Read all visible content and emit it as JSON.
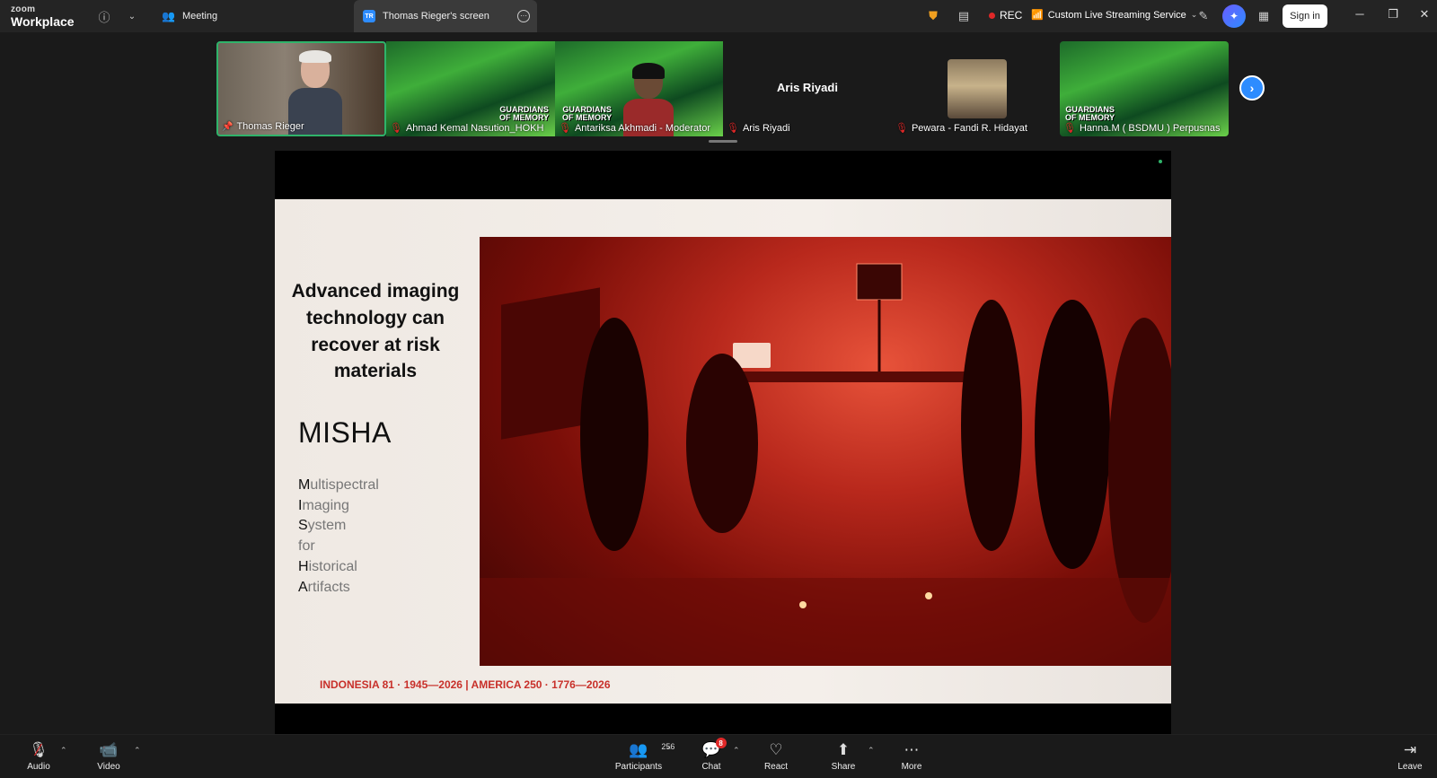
{
  "titlebar": {
    "brand_top": "zoom",
    "brand_bottom": "Workplace",
    "tab_meeting": "Meeting",
    "tab_screen": "Thomas Rieger's screen",
    "tab_screen_badge": "TR",
    "rec": "REC",
    "stream": "Custom Live Streaming Service",
    "signin": "Sign in"
  },
  "participants": [
    {
      "name": "Thomas Rieger",
      "muted": false,
      "pinned": true
    },
    {
      "name": "Ahmad Kemal Nasution_HOKH",
      "muted": true
    },
    {
      "name": "Antariksa Akhmadi - Moderator",
      "muted": true
    },
    {
      "name": "Aris Riyadi",
      "muted": true,
      "display_name": "Aris Riyadi"
    },
    {
      "name": "Pewara - Fandi R. Hidayat",
      "muted": true
    },
    {
      "name": "Hanna.M ( BSDMU ) Perpusnas",
      "muted": true
    }
  ],
  "thumb_branding": {
    "line1": "GUARDIANS",
    "line2": "OF MEMORY"
  },
  "slide": {
    "title": "Advanced imaging technology  can recover at risk materials",
    "acronym_title": "MISHA",
    "acronym": [
      {
        "cap": "M",
        "rest": "ultispectral"
      },
      {
        "cap": "I",
        "rest": "maging"
      },
      {
        "cap": "S",
        "rest": "ystem"
      },
      {
        "cap": "",
        "rest": "for"
      },
      {
        "cap": "H",
        "rest": "istorical"
      },
      {
        "cap": "A",
        "rest": "rtifacts"
      }
    ],
    "footer": "INDONESIA 81 · 1945—2026   |   AMERICA 250 · 1776—2026"
  },
  "bottombar": {
    "audio": "Audio",
    "video": "Video",
    "participants": "Participants",
    "participants_count": "256",
    "chat": "Chat",
    "chat_badge": "8",
    "react": "React",
    "share": "Share",
    "more": "More",
    "leave": "Leave"
  },
  "colors": {
    "accent": "#2d8cff",
    "active_speaker": "#2fb36a",
    "muted": "#e02828",
    "slide_footer": "#c8302a"
  }
}
